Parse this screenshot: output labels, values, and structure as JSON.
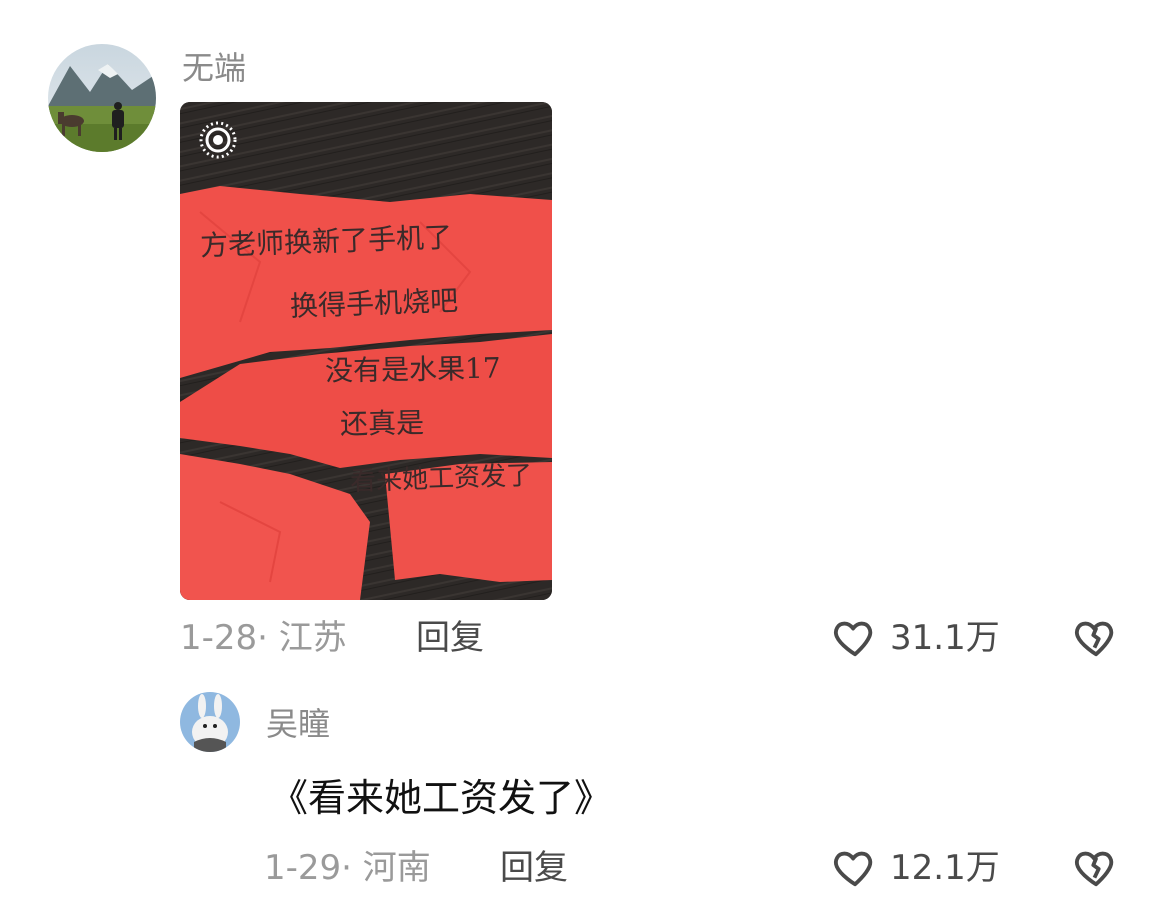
{
  "comments": [
    {
      "username": "无端",
      "date_location": "1-28· 江苏",
      "reply_label": "回复",
      "like_count": "31.1万",
      "image": {
        "handwritten_lines": [
          "方老师换新了手机了",
          "换得手机烧吧",
          "没有是水果17",
          "还真是",
          "看来她工资发了"
        ]
      }
    },
    {
      "username": "吴瞳",
      "text": "《看来她工资发了》",
      "date_location": "1-29· 河南",
      "reply_label": "回复",
      "like_count": "12.1万"
    }
  ],
  "icons": {
    "like": "heart-outline-icon",
    "dislike": "broken-heart-icon",
    "live_photo": "live-photo-icon"
  },
  "colors": {
    "paper_red": "#f0504a",
    "text_gray": "#9a9a9a",
    "text_dark": "#4a4a4a"
  }
}
